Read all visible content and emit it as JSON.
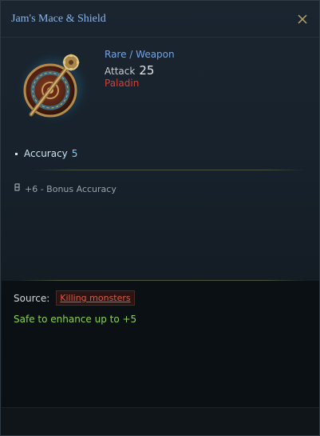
{
  "item": {
    "title": "Jam's Mace & Shield",
    "rarity_type": "Rare / Weapon",
    "attack_label": "Attack",
    "attack_value": "25",
    "class_requirement": "Paladin",
    "icon": "mace-and-shield-icon"
  },
  "stats": {
    "primary_label": "Accuracy",
    "primary_value": "5",
    "bonus_text": "+6 - Bonus Accuracy",
    "bonus_icon": "bonus-rune-icon"
  },
  "footer": {
    "source_label": "Source:",
    "source_link": "Killing monsters",
    "enhance_text": "Safe to enhance up to +5"
  },
  "colors": {
    "title": "#8bb4e8",
    "rarity": "#6fa4ec",
    "class_requirement": "#e03a2e",
    "stat_value": "#7fd0ff",
    "source_link": "#d65c4a",
    "enhance": "#8bd24c"
  }
}
